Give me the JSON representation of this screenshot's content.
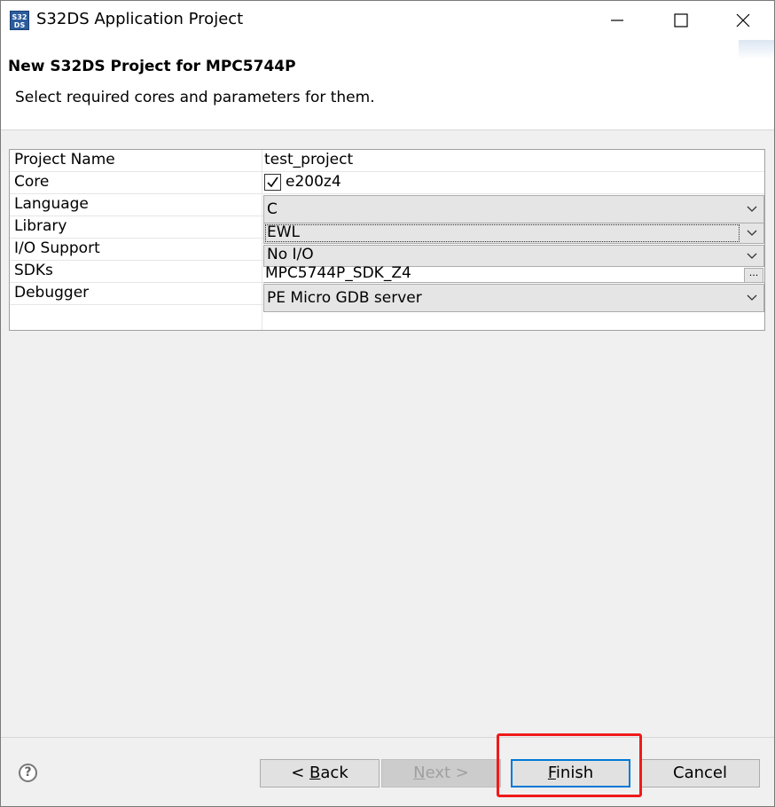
{
  "window": {
    "title": "S32DS Application Project",
    "icon_text": "S32\nDS"
  },
  "banner": {
    "title": "New S32DS Project for MPC5744P",
    "description": "Select required cores and parameters for them."
  },
  "properties": {
    "project_name": {
      "label": "Project Name",
      "value": "test_project"
    },
    "core": {
      "label": "Core",
      "value": "e200z4",
      "checked": true
    },
    "language": {
      "label": "Language",
      "value": "C"
    },
    "library": {
      "label": "Library",
      "value": "EWL"
    },
    "io_support": {
      "label": "I/O Support",
      "value": "No I/O"
    },
    "sdks": {
      "label": "SDKs",
      "value": "MPC5744P_SDK_Z4",
      "browse_label": "..."
    },
    "debugger": {
      "label": "Debugger",
      "value": "PE Micro GDB server"
    }
  },
  "buttons": {
    "back": {
      "prefix": "< ",
      "accel": "B",
      "rest": "ack"
    },
    "next": {
      "accel": "N",
      "rest": "ext >"
    },
    "finish": {
      "accel": "F",
      "rest": "inish"
    },
    "cancel": "Cancel"
  },
  "help_symbol": "?",
  "colors": {
    "highlight": "#f01a1a",
    "default_button_border": "#0078d7"
  }
}
